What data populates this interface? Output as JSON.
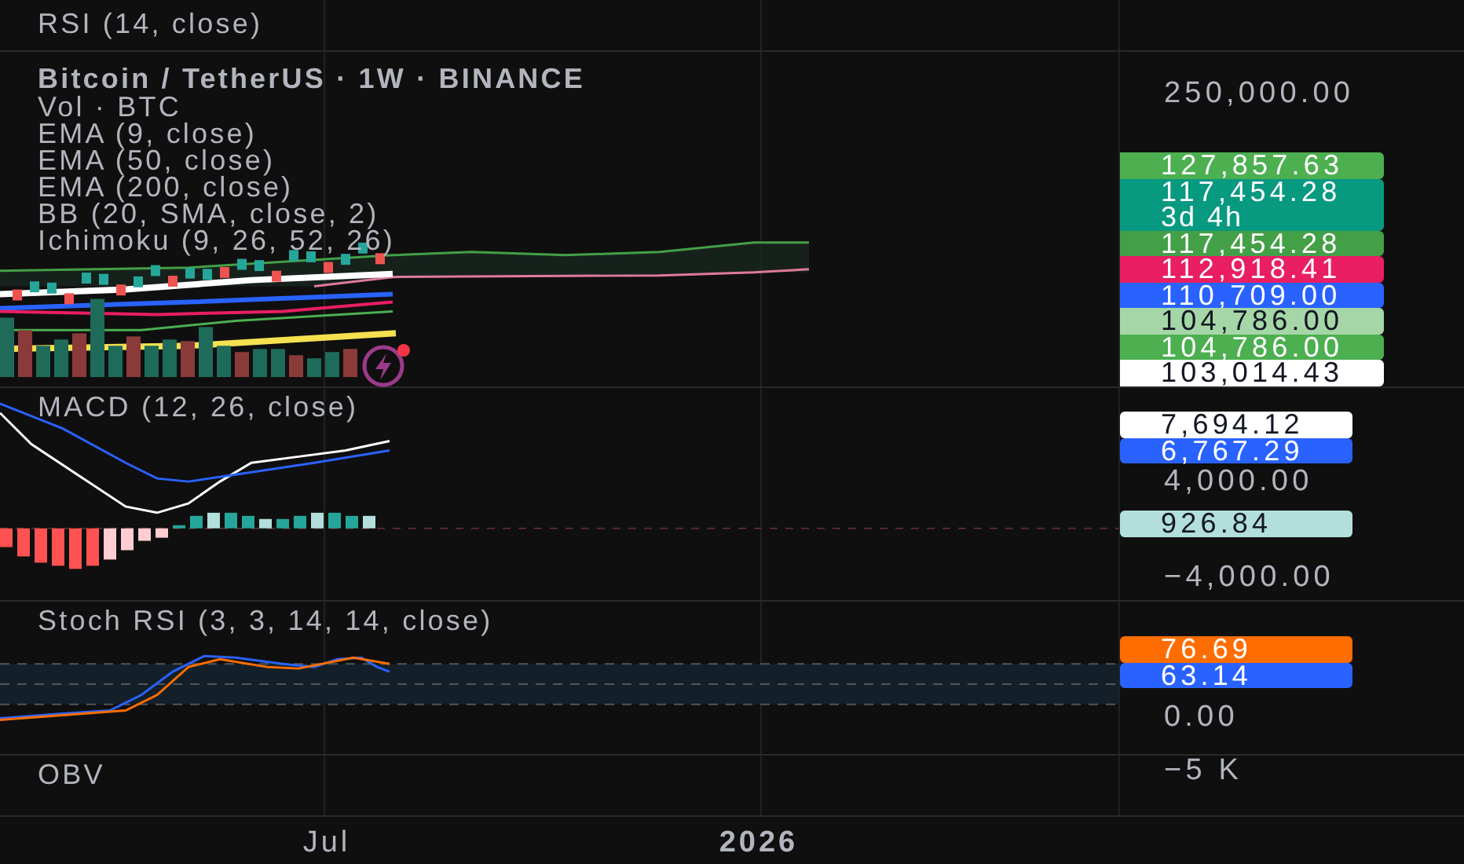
{
  "top_pane": {
    "legend": "RSI (14, close)"
  },
  "main_pane": {
    "title": "Bitcoin / TetherUS · 1W · BINANCE",
    "indicators": [
      "Vol · BTC",
      "EMA (9, close)",
      "EMA (50, close)",
      "EMA (200, close)",
      "BB (20, SMA, close, 2)",
      "Ichimoku (9, 26, 52, 26)"
    ],
    "axis": [
      {
        "kind": "label",
        "value": "250,000.00"
      },
      {
        "kind": "tag",
        "value": "127,857.63",
        "color": "#4caf50"
      },
      {
        "kind": "tag",
        "value": "117,454.28",
        "countdown": "3d 4h",
        "color": "#089981"
      },
      {
        "kind": "tag",
        "value": "117,454.28",
        "color": "#43a047"
      },
      {
        "kind": "tag",
        "value": "112,918.41",
        "color": "#e91e63"
      },
      {
        "kind": "tag",
        "value": "110,709.00",
        "color": "#2962ff"
      },
      {
        "kind": "tag",
        "value": "104,786.00",
        "color": "#a5d6a7"
      },
      {
        "kind": "tag",
        "value": "104,786.00",
        "color": "#4caf50"
      },
      {
        "kind": "tag",
        "value": "103,014.43",
        "color": "#ffffff"
      }
    ]
  },
  "macd_pane": {
    "legend": "MACD (12, 26, close)",
    "axis": [
      {
        "kind": "tag",
        "value": "7,694.12",
        "color": "#ffffff"
      },
      {
        "kind": "tag",
        "value": "6,767.29",
        "color": "#2962ff"
      },
      {
        "kind": "label",
        "value": "4,000.00"
      },
      {
        "kind": "tag",
        "value": "926.84",
        "color": "#b2dfdb"
      },
      {
        "kind": "label",
        "value": "−4,000.00"
      }
    ]
  },
  "stoch_pane": {
    "legend": "Stoch RSI (3, 3, 14, 14, close)",
    "axis": [
      {
        "kind": "tag",
        "value": "76.69",
        "color": "#ff6d00"
      },
      {
        "kind": "tag",
        "value": "63.14",
        "color": "#2962ff"
      },
      {
        "kind": "label",
        "value": "0.00"
      }
    ]
  },
  "obv_pane": {
    "legend": "OBV",
    "axis": [
      {
        "kind": "label",
        "value": "−5 K"
      }
    ]
  },
  "time_axis": [
    {
      "kind": "month",
      "label": "Jul"
    },
    {
      "kind": "year",
      "label": "2026"
    }
  ]
}
